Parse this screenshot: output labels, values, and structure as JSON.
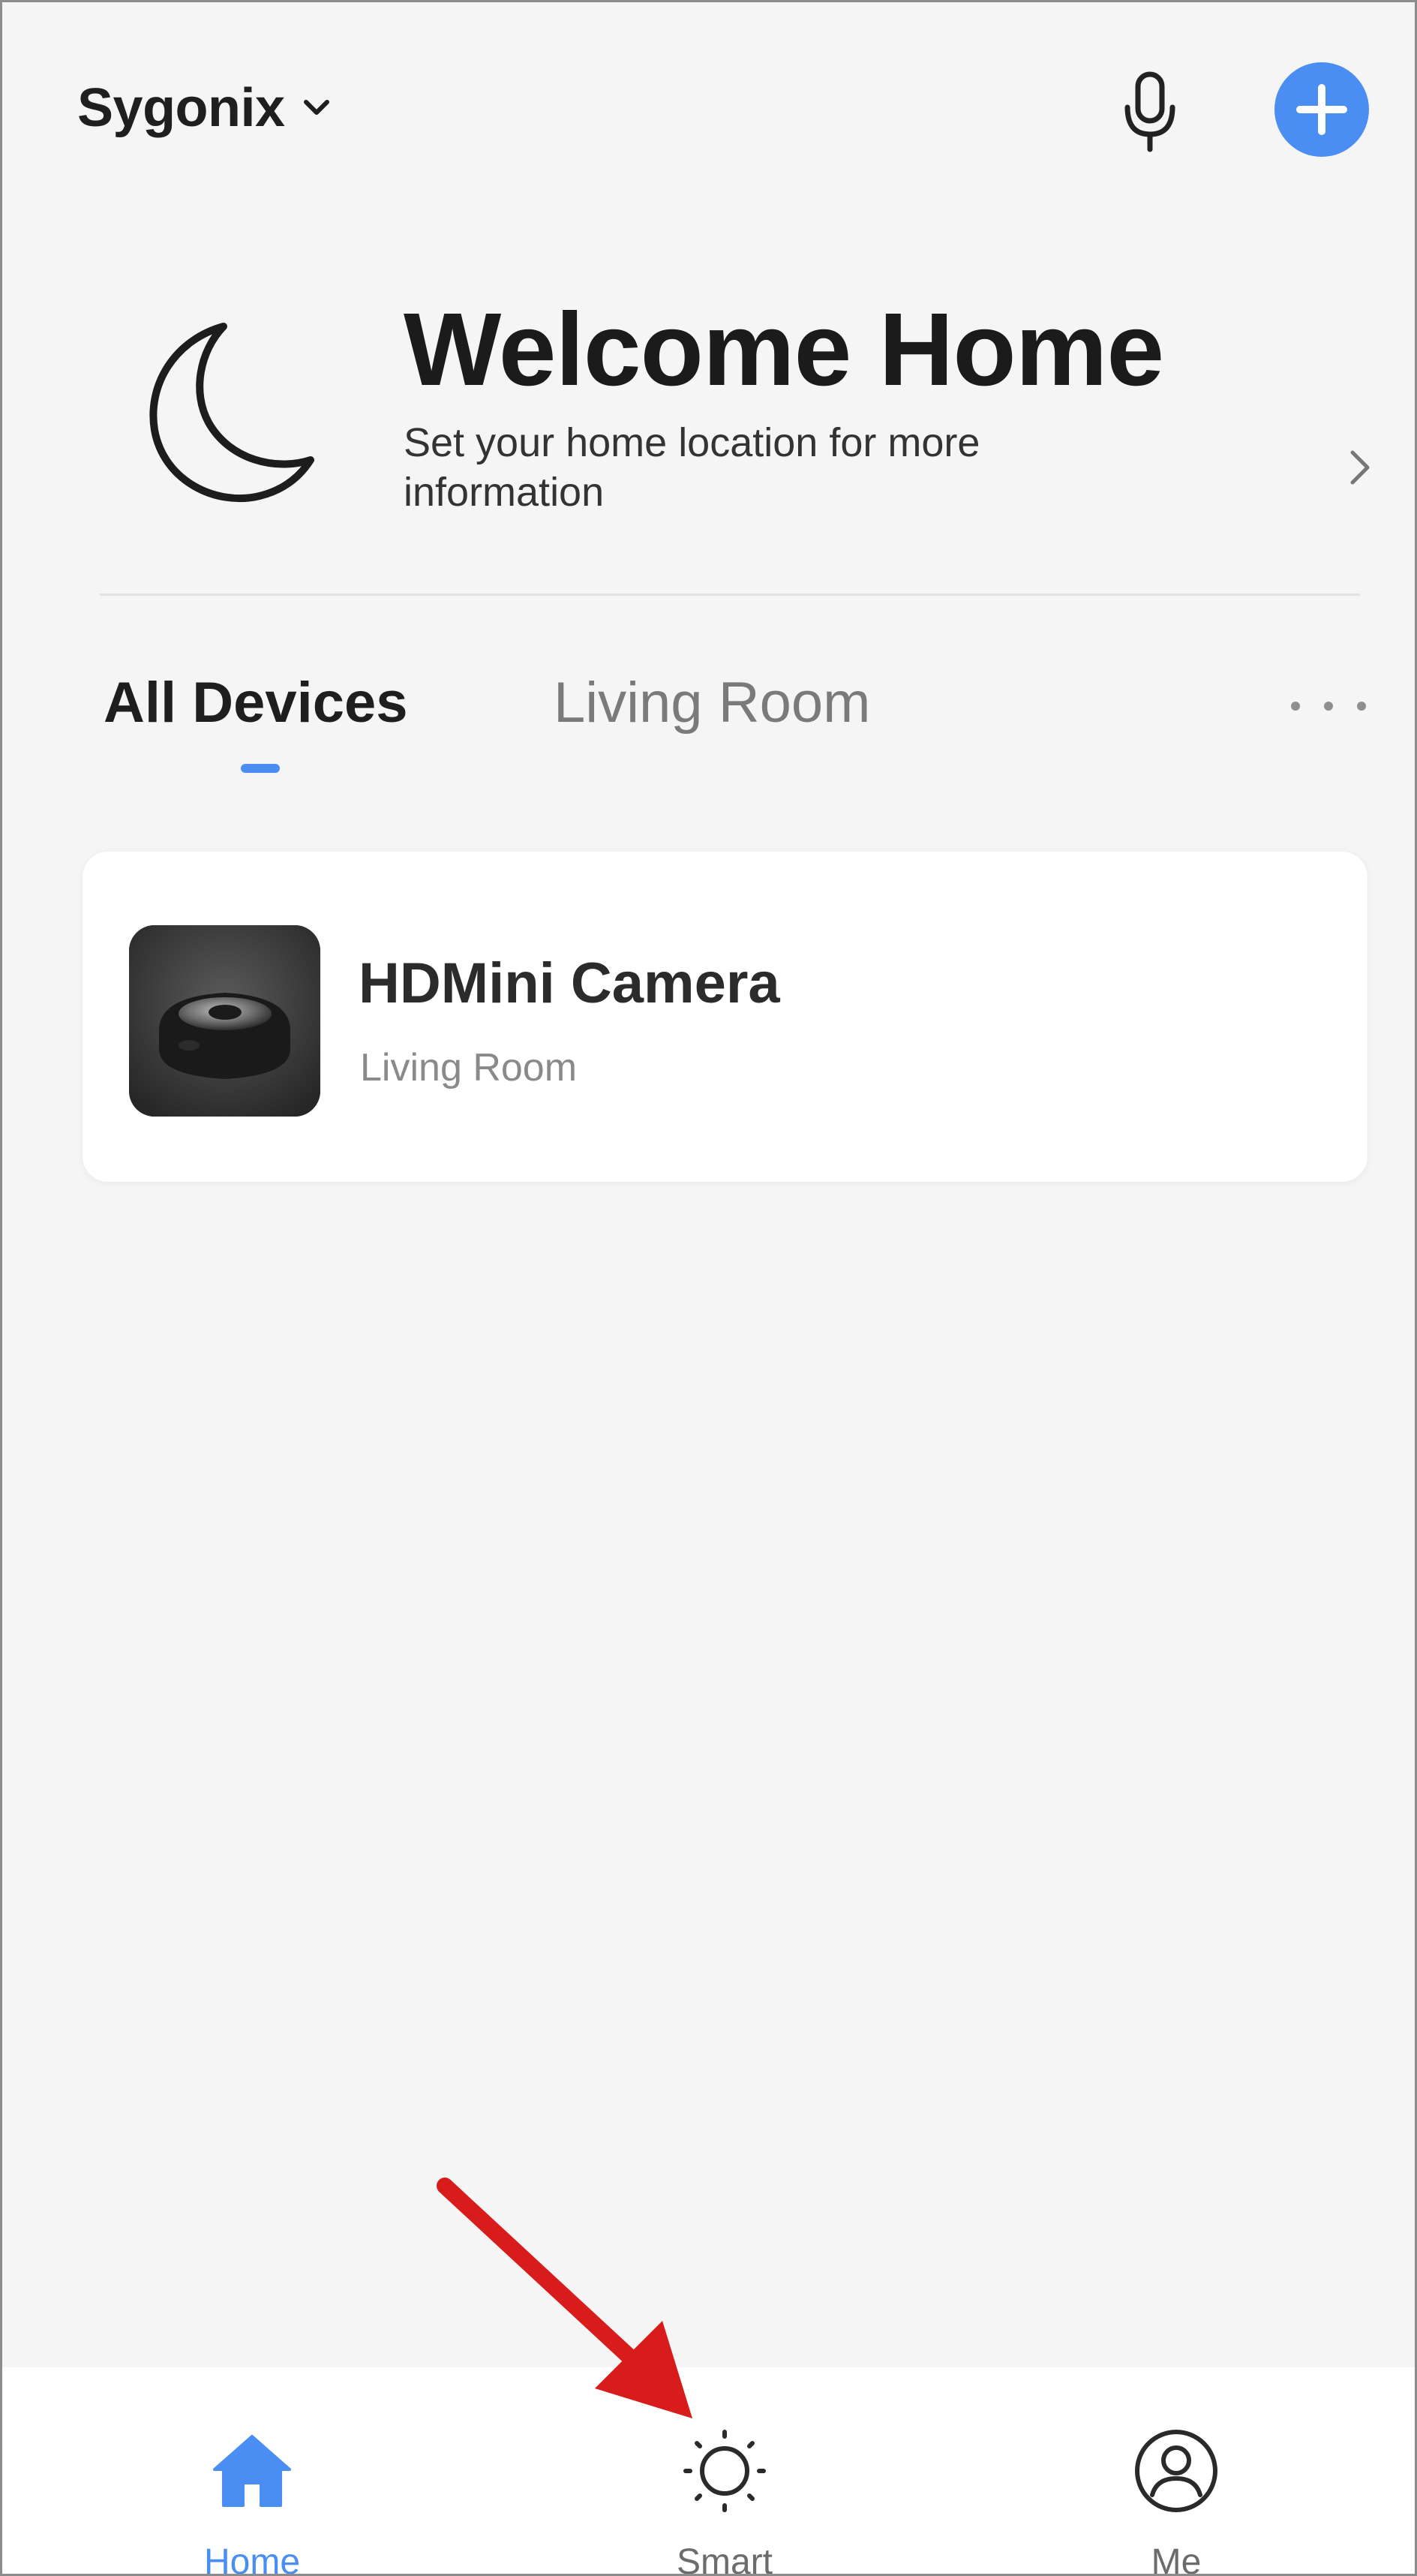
{
  "header": {
    "home_name": "Sygonix",
    "icons": {
      "dropdown": "chevron-down-icon",
      "mic": "microphone-icon",
      "add": "plus-icon"
    },
    "colors": {
      "accent": "#4a8ef4"
    }
  },
  "welcome": {
    "title": "Welcome Home",
    "subtitle": "Set your home location for more information",
    "icons": {
      "moon": "moon-icon",
      "chevron": "chevron-right-icon"
    }
  },
  "tabs": {
    "items": [
      {
        "label": "All Devices",
        "active": true
      },
      {
        "label": "Living Room",
        "active": false
      }
    ],
    "more_icon": "more-dots-icon"
  },
  "devices": [
    {
      "name": "HDMini Camera",
      "room": "Living Room",
      "thumbnail": "camera-thumbnail"
    }
  ],
  "bottom_nav": {
    "items": [
      {
        "label": "Home",
        "icon": "home-icon",
        "active": true
      },
      {
        "label": "Smart",
        "icon": "sun-icon",
        "active": false
      },
      {
        "label": "Me",
        "icon": "user-icon",
        "active": false
      }
    ]
  },
  "annotation": {
    "type": "red-arrow",
    "target": "Smart",
    "color": "#d81b1b"
  }
}
